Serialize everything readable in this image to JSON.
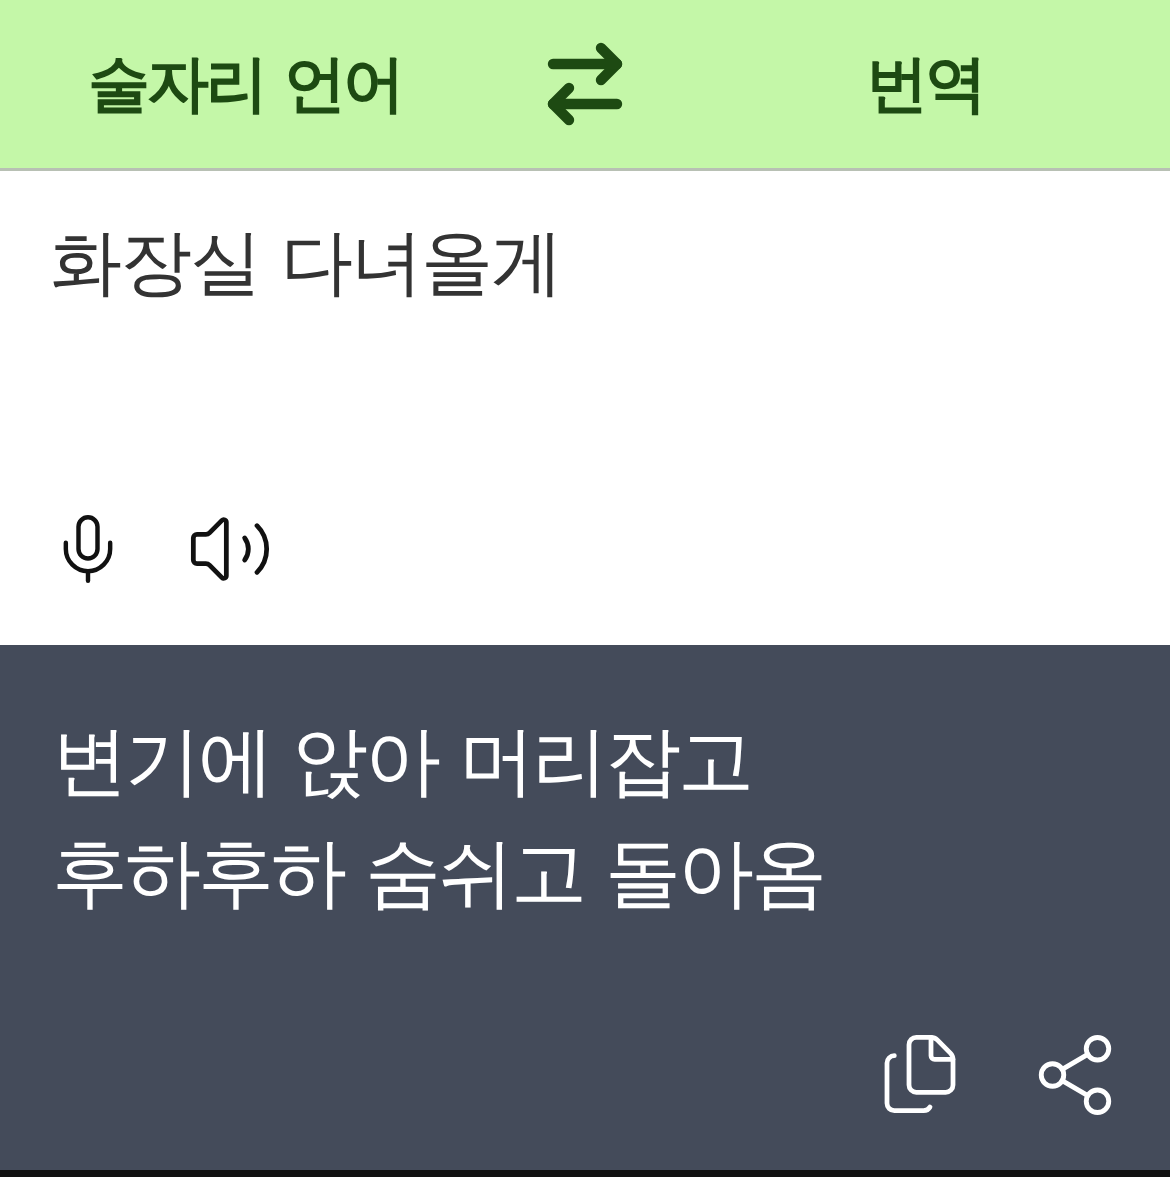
{
  "header": {
    "source_language": "술자리 언어",
    "target_language": "번역"
  },
  "input": {
    "value": "화장실 다녀올게"
  },
  "output": {
    "lines": [
      "변기에 앉아 머리잡고",
      "후하후하 숨쉬고 돌아옴"
    ]
  }
}
